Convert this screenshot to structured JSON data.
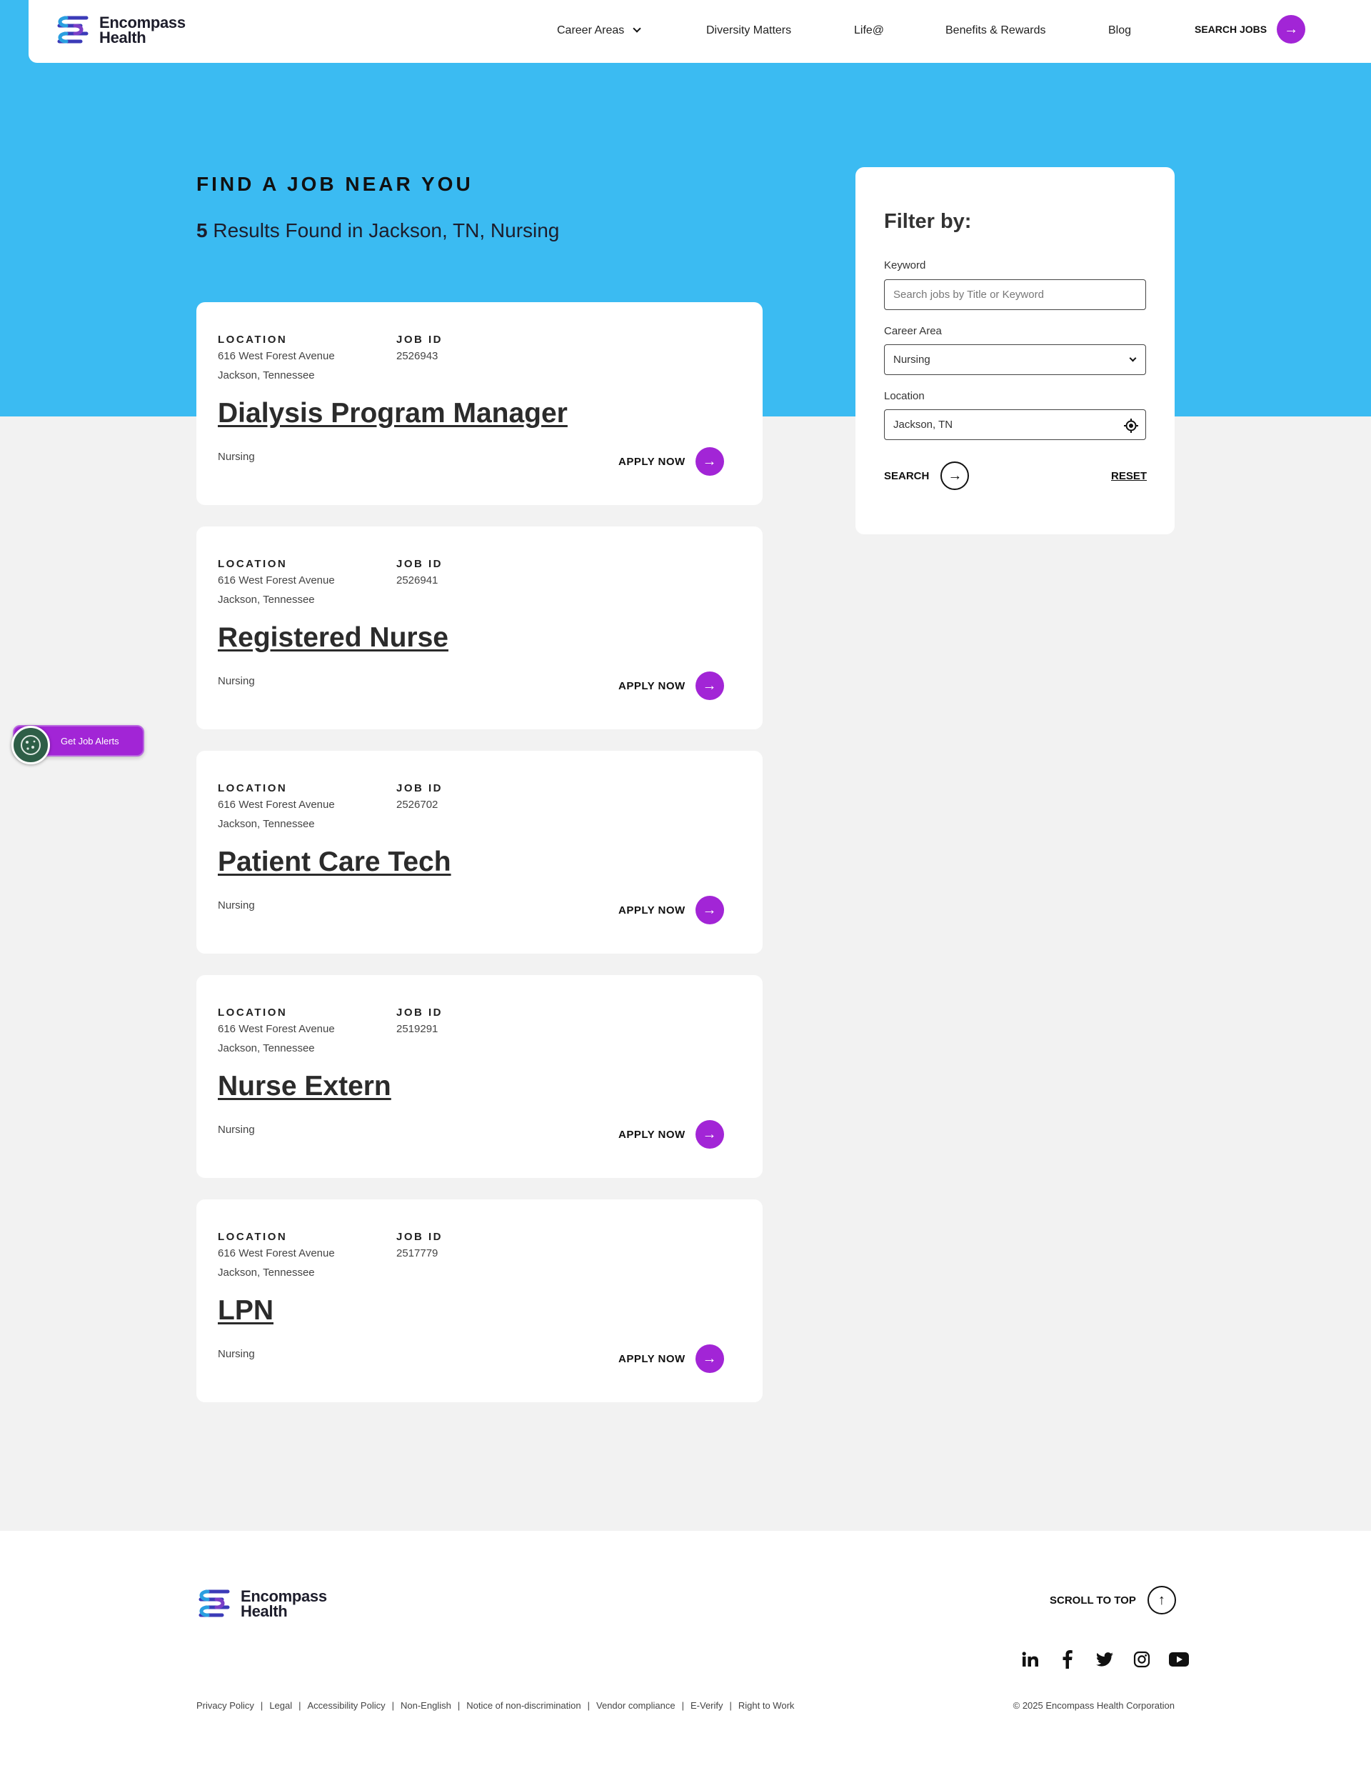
{
  "brand": {
    "name_line1": "Encompass",
    "name_line2": "Health",
    "purple": "#a225d6",
    "sky": "#3bbbf2"
  },
  "nav": {
    "items": [
      "Career Areas",
      "Diversity Matters",
      "Life@",
      "Benefits & Rewards",
      "Blog"
    ],
    "search_jobs": "SEARCH JOBS"
  },
  "hero": {
    "title": "FIND A JOB NEAR YOU",
    "results_count": "5",
    "results_text": "Results Found in Jackson, TN, Nursing"
  },
  "labels": {
    "location": "LOCATION",
    "job_id": "JOB ID",
    "apply": "APPLY NOW"
  },
  "jobs": [
    {
      "address1": "616 West Forest Avenue",
      "address2": "Jackson, Tennessee",
      "job_id": "2526943",
      "title": "Dialysis Program Manager",
      "category": "Nursing"
    },
    {
      "address1": "616 West Forest Avenue",
      "address2": "Jackson, Tennessee",
      "job_id": "2526941",
      "title": "Registered Nurse",
      "category": "Nursing"
    },
    {
      "address1": "616 West Forest Avenue",
      "address2": "Jackson, Tennessee",
      "job_id": "2526702",
      "title": "Patient Care Tech",
      "category": "Nursing"
    },
    {
      "address1": "616 West Forest Avenue",
      "address2": "Jackson, Tennessee",
      "job_id": "2519291",
      "title": "Nurse Extern",
      "category": "Nursing"
    },
    {
      "address1": "616 West Forest Avenue",
      "address2": "Jackson, Tennessee",
      "job_id": "2517779",
      "title": "LPN",
      "category": "Nursing"
    }
  ],
  "filter": {
    "title": "Filter by:",
    "keyword_label": "Keyword",
    "keyword_placeholder": "Search jobs by Title or Keyword",
    "career_label": "Career Area",
    "career_value": "Nursing",
    "location_label": "Location",
    "location_value": "Jackson, TN",
    "search": "SEARCH",
    "reset": "RESET"
  },
  "job_alerts": "Get Job Alerts",
  "footer": {
    "scroll_top": "SCROLL TO TOP",
    "socials": [
      "linkedin-icon",
      "facebook-icon",
      "twitter-icon",
      "instagram-icon",
      "youtube-icon"
    ],
    "links": [
      "Privacy Policy",
      "Legal",
      "Accessibility Policy",
      "Non-English",
      "Notice of non-discrimination",
      "Vendor compliance",
      "E-Verify",
      "Right to Work"
    ],
    "copyright": "© 2025 Encompass Health Corporation"
  }
}
